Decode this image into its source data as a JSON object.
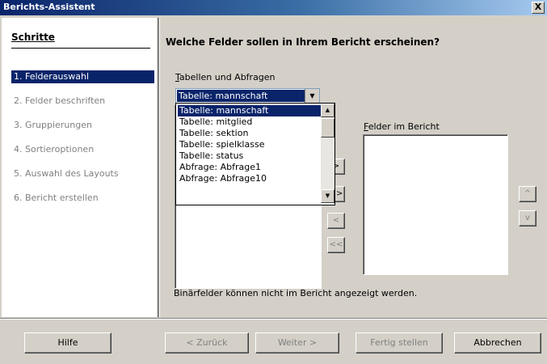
{
  "window": {
    "title": "Berichts-Assistent",
    "close_label": "X"
  },
  "steps": {
    "heading": "Schritte",
    "items": [
      {
        "label": "1. Felderauswahl",
        "active": true
      },
      {
        "label": "2. Felder beschriften",
        "active": false
      },
      {
        "label": "3. Gruppierungen",
        "active": false
      },
      {
        "label": "4. Sortieroptionen",
        "active": false
      },
      {
        "label": "5. Auswahl des Layouts",
        "active": false
      },
      {
        "label": "6. Bericht erstellen",
        "active": false
      }
    ]
  },
  "main": {
    "question": "Welche Felder sollen in Ihrem Bericht erscheinen?",
    "tables_label_mnemonic": "T",
    "tables_label_rest": "abellen und Abfragen",
    "combo_value": "Tabelle: mannschaft",
    "dropdown_items": [
      "Tabelle: mannschaft",
      "Tabelle: mitglied",
      "Tabelle: sektion",
      "Tabelle: spielklasse",
      "Tabelle: status",
      "Abfrage: Abfrage1",
      "Abfrage: Abfrage10"
    ],
    "report_fields_label_mnemonic": "F",
    "report_fields_label_rest": "elder im Bericht",
    "move_buttons": [
      ">",
      ">>",
      "<",
      "<<"
    ],
    "order_buttons": [
      "^",
      "v"
    ],
    "note": "Binärfelder können nicht im Bericht angezeigt werden."
  },
  "footer": {
    "help": "Hilfe",
    "back": "< Zurück",
    "next": "Weiter >",
    "finish": "Fertig stellen",
    "cancel": "Abbrechen"
  },
  "colors": {
    "selection": "#0a246a",
    "face": "#d4d0c8",
    "title_start": "#0a246a"
  }
}
